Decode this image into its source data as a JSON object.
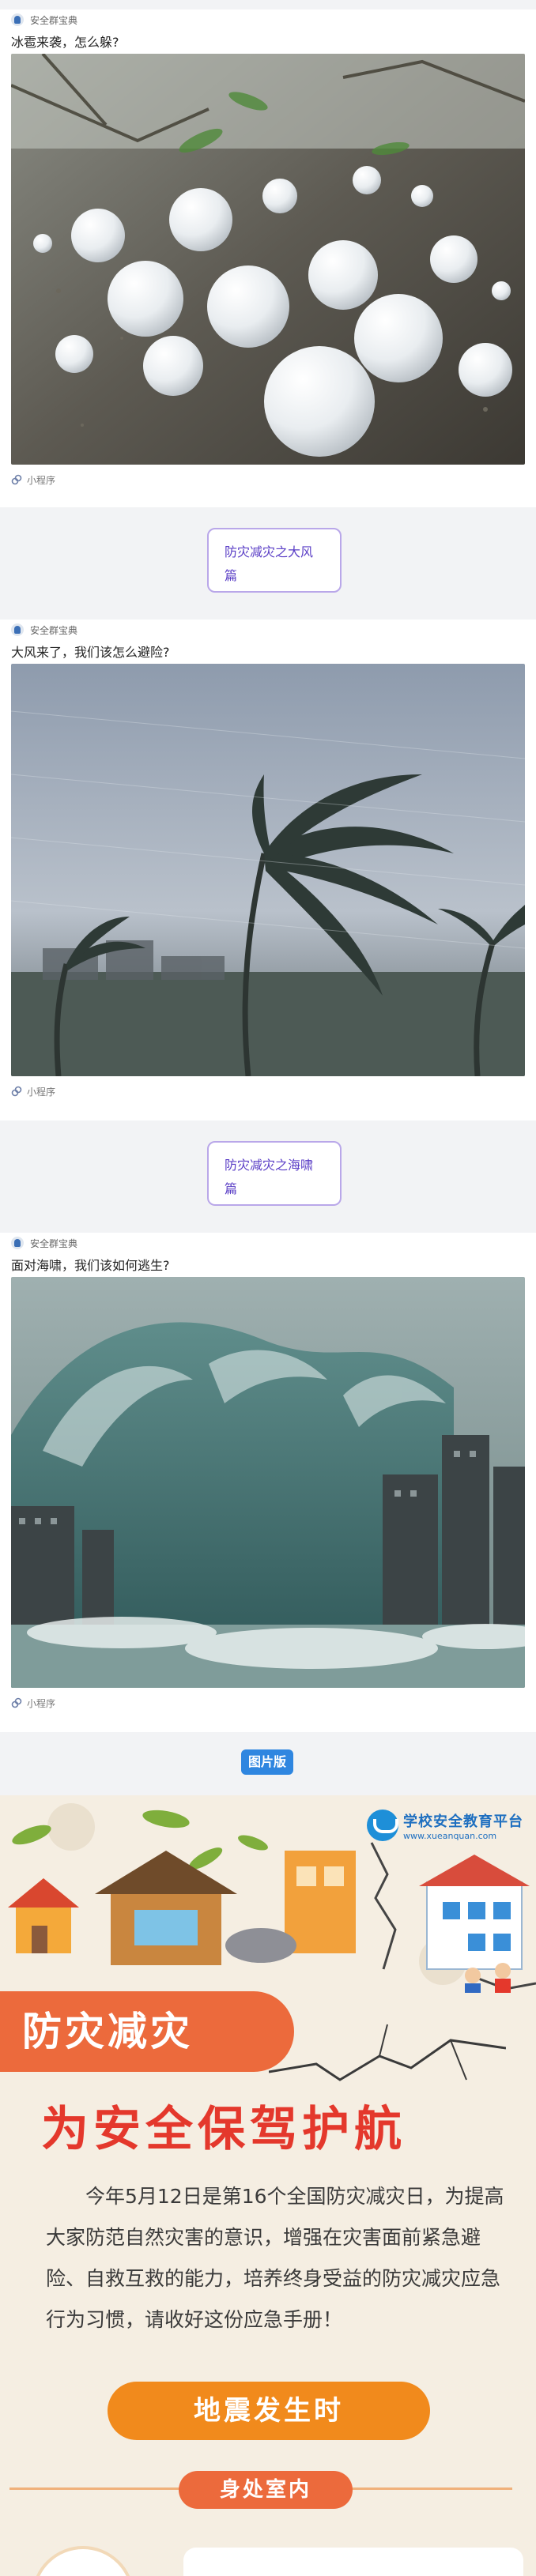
{
  "cards": [
    {
      "source": "安全群宝典",
      "title": "冰雹来袭，怎么躲?",
      "footer": "小程序",
      "image_subject": "hailstones on gravel ground"
    },
    {
      "source": "安全群宝典",
      "title": "大风来了，我们该怎么避险?",
      "footer": "小程序",
      "image_subject": "palm trees bending in a storm"
    },
    {
      "source": "安全群宝典",
      "title": "面对海啸，我们该如何逃生?",
      "footer": "小程序",
      "image_subject": "giant tsunami wave hitting city buildings"
    }
  ],
  "tags": [
    "防灾减灾之大风篇",
    "防灾减灾之海啸篇"
  ],
  "picture_label": "图片版",
  "poster": {
    "platform_name": "学校安全教育平台",
    "platform_url": "www.xueanquan.com",
    "banner": "防灾减灾",
    "headline": "为安全保驾护航",
    "intro": "今年5月12日是第16个全国防灾减灾日，为提高大家防范自然灾害的意识，增强在灾害面前紧急避险、自救互救的能力，培养终身受益的防灾减灾应急行为习惯，请收好这份应急手册！",
    "section": "地震发生时",
    "subsection": "身处室内"
  },
  "colors": {
    "tag_border": "#b9a7e9",
    "tag_text": "#5a3ec6",
    "picture_label_bg": "#2f86e0",
    "banner_bg": "#ec6a3c",
    "headline": "#e4382c",
    "section_bg": "#f18a1c",
    "poster_bg": "#f5eee2"
  }
}
